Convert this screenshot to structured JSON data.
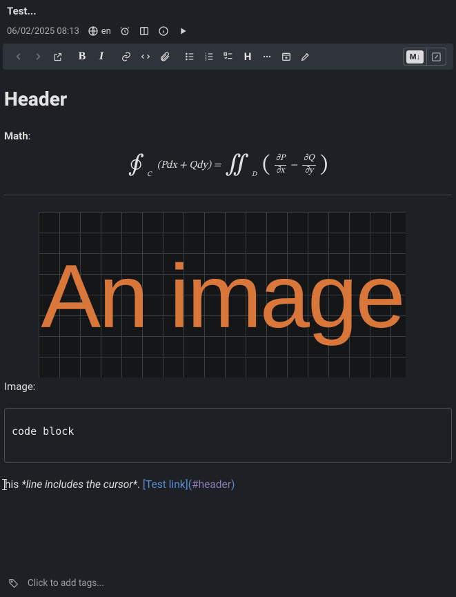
{
  "title": "Test...",
  "meta": {
    "datetime": "06/02/2025 08:13",
    "lang": "en"
  },
  "toolbar": {
    "bold": "B",
    "italic": "I",
    "heading": "H",
    "md_badge": "M↓"
  },
  "doc": {
    "header": "Header",
    "math_label": "Math",
    "math": {
      "oint_sub": "C",
      "inner1": "(Pdx + Qdy) =",
      "dbl_sub": "D",
      "frac1_num": "∂P",
      "frac1_den": "∂x",
      "minus": "−",
      "frac2_num": "∂Q",
      "frac2_den": "∂y"
    },
    "image_text": "An image",
    "image_caption": "Image:",
    "code": "code block",
    "cursor_line": {
      "t1": "his ",
      "italic": "*line includes the cursor*",
      "t2": ". ",
      "link_open": "[",
      "link_text": "Test link",
      "link_mid": "](",
      "link_hash": "#header",
      "link_close": ")"
    }
  },
  "tags": {
    "placeholder": "Click to add tags..."
  }
}
